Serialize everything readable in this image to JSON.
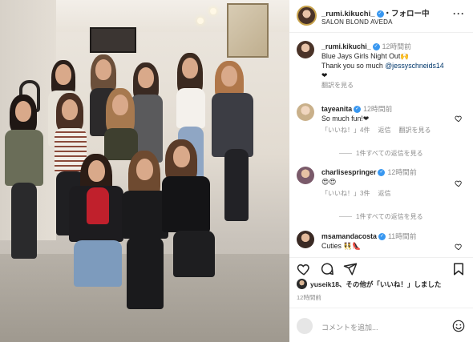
{
  "post": {
    "username": "_rumi.kikuchi_",
    "follow_label": "フォロー中",
    "separator": "・",
    "location": "SALON BLOND AVEDA",
    "more_icon": "more-horizontal-icon"
  },
  "caption": {
    "username": "_rumi.kikuchi_",
    "time": "12時間前",
    "line1": "Blue Jays Girls Night Out",
    "line1_emoji": "🙌",
    "line2_prefix": "Thank you so much ",
    "mention": "@jessyschneids14",
    "line3": "❤",
    "translate": "翻訳を見る"
  },
  "comments": [
    {
      "username": "tayeanita",
      "time": "12時間前",
      "text": "So much fun!❤",
      "likes": "「いいね！」4件",
      "reply": "返信",
      "translate": "翻訳を見る",
      "view_replies": "1件すべての返信を見る",
      "avatar_color": "#c9b08a"
    },
    {
      "username": "charlisespringer",
      "time": "12時間前",
      "text": "😍😍",
      "likes": "「いいね！」3件",
      "reply": "返信",
      "view_replies": "1件すべての返信を見る",
      "avatar_color": "#7a5a6a"
    },
    {
      "username": "msamandacosta",
      "time": "11時間前",
      "text": "Cuties 👯👠",
      "avatar_color": "#3a2a24"
    }
  ],
  "actions": {
    "like_icon": "heart-icon",
    "comment_icon": "comment-icon",
    "share_icon": "share-icon",
    "save_icon": "bookmark-icon"
  },
  "likes_line": {
    "user": "yuseik18",
    "suffix": "、その他が「いいね！」しました"
  },
  "post_time": "12時間前",
  "add_comment": {
    "placeholder": "コメントを追加...",
    "emoji_icon": "smiley-icon"
  },
  "colors": {
    "verified": "#3897f0",
    "secondary_text": "#8e8e8e",
    "mention": "#00376b",
    "divider": "#efefef"
  }
}
